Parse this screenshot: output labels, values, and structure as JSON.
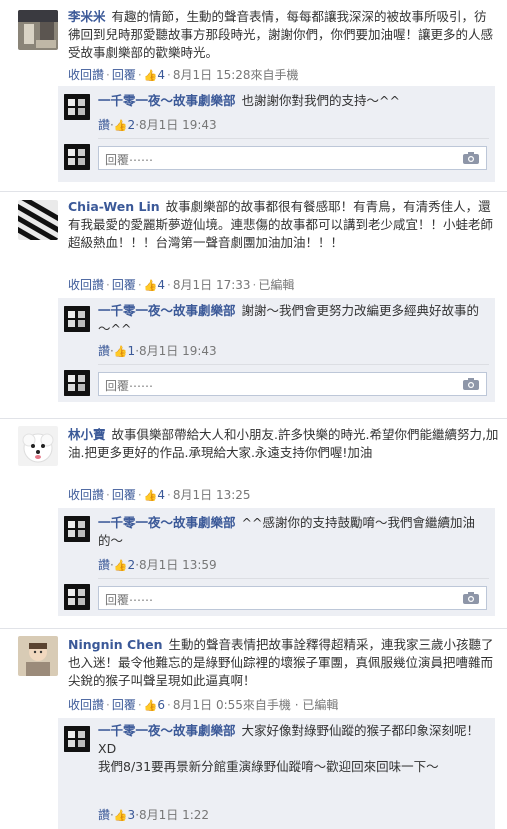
{
  "labels": {
    "reply_link": "回覆",
    "like_back": "收回讚",
    "like": "讚",
    "reply_placeholder": "回覆⋯⋯",
    "page_name": "一千零一夜～故事劇樂部"
  },
  "comments": [
    {
      "author": "李米米",
      "text": "有趣的情節，生動的聲音表情，每每都讓我深深的被故事所吸引，彷彿回到兒時那愛聽故事方那段時光，謝謝你們，你們要加油喔！讓更多的人感受故事劇樂部的歡樂時光。",
      "likes": "4",
      "time": "8月1日 15:28",
      "extra": "來自手機",
      "reply": {
        "text": "也謝謝你對我們的支持～^^",
        "likes": "2",
        "time": "8月1日 19:43"
      }
    },
    {
      "author": "Chia-Wen Lin",
      "text": "故事劇樂部的故事都很有餐感耶！有青鳥，有清秀佳人，還有我最愛的愛麗斯夢遊仙境。連悲傷的故事都可以講到老少咸宜！！小蛙老師超級熱血！！！台灣第一聲音劇團加油加油！！！",
      "likes": "4",
      "time": "8月1日 17:33",
      "extra": "已編輯",
      "reply": {
        "text": "謝謝～我們會更努力改編更多經典好故事的～^^",
        "likes": "1",
        "time": "8月1日 19:43"
      }
    },
    {
      "author": "林小寶",
      "text": "故事俱樂部帶給大人和小朋友.許多快樂的時光.希望你們能繼續努力,加油.把更多更好的作品.承現給大家.永遠支持你們喔!加油",
      "likes": "4",
      "time": "8月1日 13:25",
      "extra": "",
      "reply": {
        "text": "^^感謝你的支持鼓勵唷～我們會繼續加油的～",
        "likes": "2",
        "time": "8月1日 13:59"
      }
    },
    {
      "author": "Ningnin Chen",
      "text": "生動的聲音表情把故事詮釋得超精采，連我家三歲小孩聽了也入迷！最令他難忘的是綠野仙踪裡的壞猴子軍團，真佩服幾位演員把嘈雜而尖銳的猴子叫聲呈現如此逼真啊！",
      "likes": "6",
      "time": "8月1日 0:55",
      "extra": "來自手機 · 已編輯",
      "reply": {
        "text": "大家好像對綠野仙蹤的猴子都印象深刻呢！XD\n我們8/31要再景新分館重演綠野仙蹤唷～歡迎回來回味一下～",
        "likes": "3",
        "time": "8月1日 1:22"
      }
    }
  ],
  "colors": {
    "link": "#3b5998",
    "reply_bg": "#edeff4",
    "muted": "#777777"
  }
}
